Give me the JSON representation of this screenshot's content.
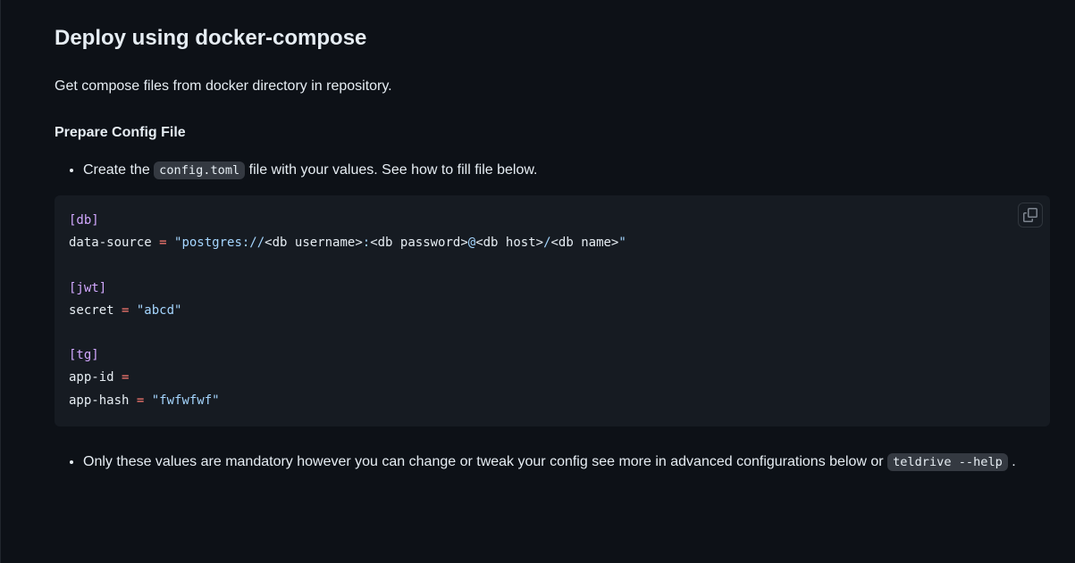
{
  "heading": "Deploy using docker-compose",
  "intro": "Get compose files from docker directory in repository.",
  "subheading": "Prepare Config File",
  "bullet1_prefix": "Create the ",
  "bullet1_code": "config.toml",
  "bullet1_suffix": " file with your values. See how to fill file below.",
  "code": {
    "db_section": "[db]",
    "db_key": "data-source",
    "db_eq": " = ",
    "db_val_open": "\"postgres://",
    "db_user": "<db username>",
    "db_colon": ":",
    "db_pass": "<db password>",
    "db_at": "@",
    "db_host": "<db host>",
    "db_slash": "/",
    "db_name": "<db name>",
    "db_val_close": "\"",
    "jwt_section": "[jwt]",
    "jwt_key": "secret",
    "jwt_eq": " = ",
    "jwt_val": "\"abcd\"",
    "tg_section": "[tg]",
    "tg_id_key": "app-id",
    "tg_id_eq": " = ",
    "tg_hash_key": "app-hash",
    "tg_hash_eq": " = ",
    "tg_hash_val": "\"fwfwfwf\""
  },
  "bullet2_prefix": "Only these values are mandatory however you can change or tweak your config see more in advanced configurations below or ",
  "bullet2_code": "teldrive --help",
  "bullet2_suffix": "."
}
